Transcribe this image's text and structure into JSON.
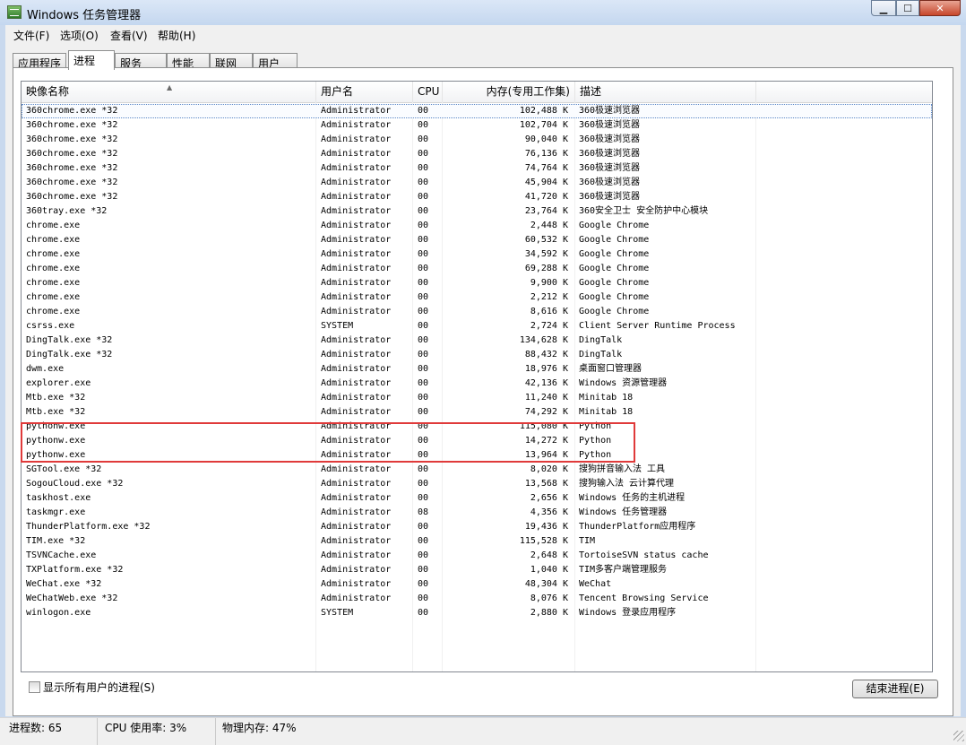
{
  "window": {
    "title": "Windows 任务管理器"
  },
  "menu": [
    "文件(F)",
    "选项(O)",
    "查看(V)",
    "帮助(H)"
  ],
  "tabs": [
    {
      "label": "应用程序",
      "active": false
    },
    {
      "label": "进程",
      "active": true
    },
    {
      "label": "服务",
      "active": false
    },
    {
      "label": "性能",
      "active": false
    },
    {
      "label": "联网",
      "active": false
    },
    {
      "label": "用户",
      "active": false
    }
  ],
  "columns": {
    "name": "映像名称",
    "user": "用户名",
    "cpu": "CPU",
    "mem": "内存(专用工作集)",
    "desc": "描述"
  },
  "processes": [
    [
      "360chrome.exe *32",
      "Administrator",
      "00",
      "102,488 K",
      "360极速浏览器"
    ],
    [
      "360chrome.exe *32",
      "Administrator",
      "00",
      "102,704 K",
      "360极速浏览器"
    ],
    [
      "360chrome.exe *32",
      "Administrator",
      "00",
      "90,040 K",
      "360极速浏览器"
    ],
    [
      "360chrome.exe *32",
      "Administrator",
      "00",
      "76,136 K",
      "360极速浏览器"
    ],
    [
      "360chrome.exe *32",
      "Administrator",
      "00",
      "74,764 K",
      "360极速浏览器"
    ],
    [
      "360chrome.exe *32",
      "Administrator",
      "00",
      "45,904 K",
      "360极速浏览器"
    ],
    [
      "360chrome.exe *32",
      "Administrator",
      "00",
      "41,720 K",
      "360极速浏览器"
    ],
    [
      "360tray.exe *32",
      "Administrator",
      "00",
      "23,764 K",
      "360安全卫士 安全防护中心模块"
    ],
    [
      "chrome.exe",
      "Administrator",
      "00",
      "2,448 K",
      "Google Chrome"
    ],
    [
      "chrome.exe",
      "Administrator",
      "00",
      "60,532 K",
      "Google Chrome"
    ],
    [
      "chrome.exe",
      "Administrator",
      "00",
      "34,592 K",
      "Google Chrome"
    ],
    [
      "chrome.exe",
      "Administrator",
      "00",
      "69,288 K",
      "Google Chrome"
    ],
    [
      "chrome.exe",
      "Administrator",
      "00",
      "9,900 K",
      "Google Chrome"
    ],
    [
      "chrome.exe",
      "Administrator",
      "00",
      "2,212 K",
      "Google Chrome"
    ],
    [
      "chrome.exe",
      "Administrator",
      "00",
      "8,616 K",
      "Google Chrome"
    ],
    [
      "csrss.exe",
      "SYSTEM",
      "00",
      "2,724 K",
      "Client Server Runtime Process"
    ],
    [
      "DingTalk.exe *32",
      "Administrator",
      "00",
      "134,628 K",
      "DingTalk"
    ],
    [
      "DingTalk.exe *32",
      "Administrator",
      "00",
      "88,432 K",
      "DingTalk"
    ],
    [
      "dwm.exe",
      "Administrator",
      "00",
      "18,976 K",
      "桌面窗口管理器"
    ],
    [
      "explorer.exe",
      "Administrator",
      "00",
      "42,136 K",
      "Windows 资源管理器"
    ],
    [
      "Mtb.exe *32",
      "Administrator",
      "00",
      "11,240 K",
      "Minitab 18"
    ],
    [
      "Mtb.exe *32",
      "Administrator",
      "00",
      "74,292 K",
      "Minitab 18"
    ],
    [
      "pythonw.exe",
      "Administrator",
      "00",
      "115,080 K",
      "Python"
    ],
    [
      "pythonw.exe",
      "Administrator",
      "00",
      "14,272 K",
      "Python"
    ],
    [
      "pythonw.exe",
      "Administrator",
      "00",
      "13,964 K",
      "Python"
    ],
    [
      "SGTool.exe *32",
      "Administrator",
      "00",
      "8,020 K",
      "搜狗拼音输入法 工具"
    ],
    [
      "SogouCloud.exe *32",
      "Administrator",
      "00",
      "13,568 K",
      "搜狗输入法 云计算代理"
    ],
    [
      "taskhost.exe",
      "Administrator",
      "00",
      "2,656 K",
      "Windows 任务的主机进程"
    ],
    [
      "taskmgr.exe",
      "Administrator",
      "08",
      "4,356 K",
      "Windows 任务管理器"
    ],
    [
      "ThunderPlatform.exe *32",
      "Administrator",
      "00",
      "19,436 K",
      "ThunderPlatform应用程序"
    ],
    [
      "TIM.exe *32",
      "Administrator",
      "00",
      "115,528 K",
      "TIM"
    ],
    [
      "TSVNCache.exe",
      "Administrator",
      "00",
      "2,648 K",
      "TortoiseSVN status cache"
    ],
    [
      "TXPlatform.exe *32",
      "Administrator",
      "00",
      "1,040 K",
      "TIM多客户端管理服务"
    ],
    [
      "WeChat.exe *32",
      "Administrator",
      "00",
      "48,304 K",
      "WeChat"
    ],
    [
      "WeChatWeb.exe *32",
      "Administrator",
      "00",
      "8,076 K",
      "Tencent Browsing Service"
    ],
    [
      "winlogon.exe",
      "SYSTEM",
      "00",
      "2,880 K",
      "Windows 登录应用程序"
    ]
  ],
  "footer": {
    "show_all_label": "显示所有用户的进程(S)",
    "show_all_checked": false,
    "end_process_label": "结束进程(E)"
  },
  "status": {
    "processes": "进程数: 65",
    "cpu": "CPU 使用率: 3%",
    "memory": "物理内存: 47%"
  }
}
